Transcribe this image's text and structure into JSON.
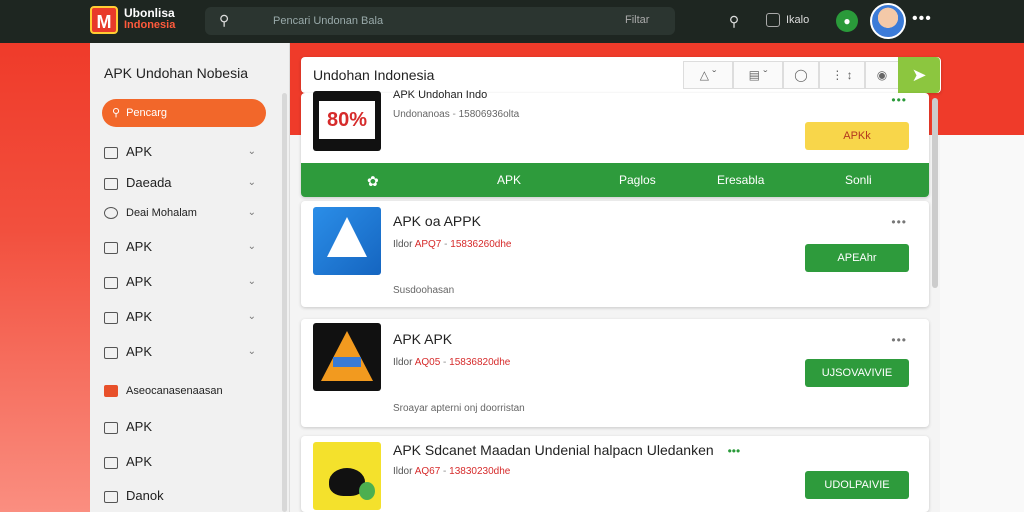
{
  "topbar": {
    "logo_letter": "M",
    "brand_line1": "Ubonlisa",
    "brand_line2": "Indonesia",
    "search_icon": "search-icon",
    "search_placeholder": "Pencari Undonan Bala",
    "search_filter": "Filtar",
    "user_label": "Ikalo",
    "menu_glyph": "•••"
  },
  "sidebar": {
    "title": "APK Undohan Nobesia",
    "pill_label": "Pencarg",
    "items": [
      {
        "label": "APK",
        "icon": "package-icon",
        "chevron": true
      },
      {
        "label": "Daeada",
        "icon": "folder-icon",
        "chevron": true
      },
      {
        "label": "Deai Mohalam",
        "icon": "clock-icon",
        "chevron": true
      },
      {
        "label": "APK",
        "icon": "package-icon",
        "chevron": true
      },
      {
        "label": "APK",
        "icon": "package-icon",
        "chevron": true
      },
      {
        "label": "APK",
        "icon": "package-icon",
        "chevron": true
      },
      {
        "label": "APK",
        "icon": "package-icon",
        "chevron": true
      },
      {
        "label": "Aseocanasenaasan",
        "icon": "fire-icon",
        "chevron": false
      },
      {
        "label": "APK",
        "icon": "package-icon",
        "chevron": false
      },
      {
        "label": "APK",
        "icon": "package-icon",
        "chevron": false
      },
      {
        "label": "Danok",
        "icon": "user-icon",
        "chevron": false
      }
    ]
  },
  "search_panel": {
    "query": "Undohan Indonesia",
    "tools": [
      "filter-icon",
      "layout-icon",
      "settings-icon",
      "sort-icon",
      "bag-icon"
    ],
    "go_icon": "send-icon"
  },
  "tabs": {
    "items": [
      "APK",
      "Paglos",
      "Eresabla",
      "Sonli"
    ],
    "first_icon": "leaf-icon"
  },
  "cards": [
    {
      "thumb_text": "80%",
      "title": "APK Undohan Indo",
      "meta_a": "Undonanoas",
      "meta_b": "15806936olta",
      "desc": "",
      "button": "APKk",
      "button_style": "yellow"
    },
    {
      "title": "APK oa APPK",
      "meta_a": "Ildor",
      "meta_b": "APQ7",
      "meta_c": "15836260dhe",
      "desc": "Susdoohasan",
      "button": "APEAhr",
      "button_style": "green"
    },
    {
      "title": "APK APK",
      "meta_a": "Ildor",
      "meta_b": "AQ05",
      "meta_c": "15836820dhe",
      "desc": "Sroayar apterni onj doorristan",
      "button": "UJSOVAVIVIE",
      "button_style": "green"
    },
    {
      "title": "APK Sdcanet Maadan Undenial halpacn Uledanken",
      "meta_a": "Ildor",
      "meta_b": "AQ67",
      "meta_c": "13830230dhe",
      "desc": "",
      "button": "UDOLPAIVIE",
      "button_style": "green"
    }
  ],
  "colors": {
    "topbar": "#1e2621",
    "brand_red": "#ef3b2a",
    "pill_orange": "#f2672a",
    "green": "#2e9b3c",
    "yellow": "#f8d64a",
    "go_green": "#8cc63f"
  }
}
